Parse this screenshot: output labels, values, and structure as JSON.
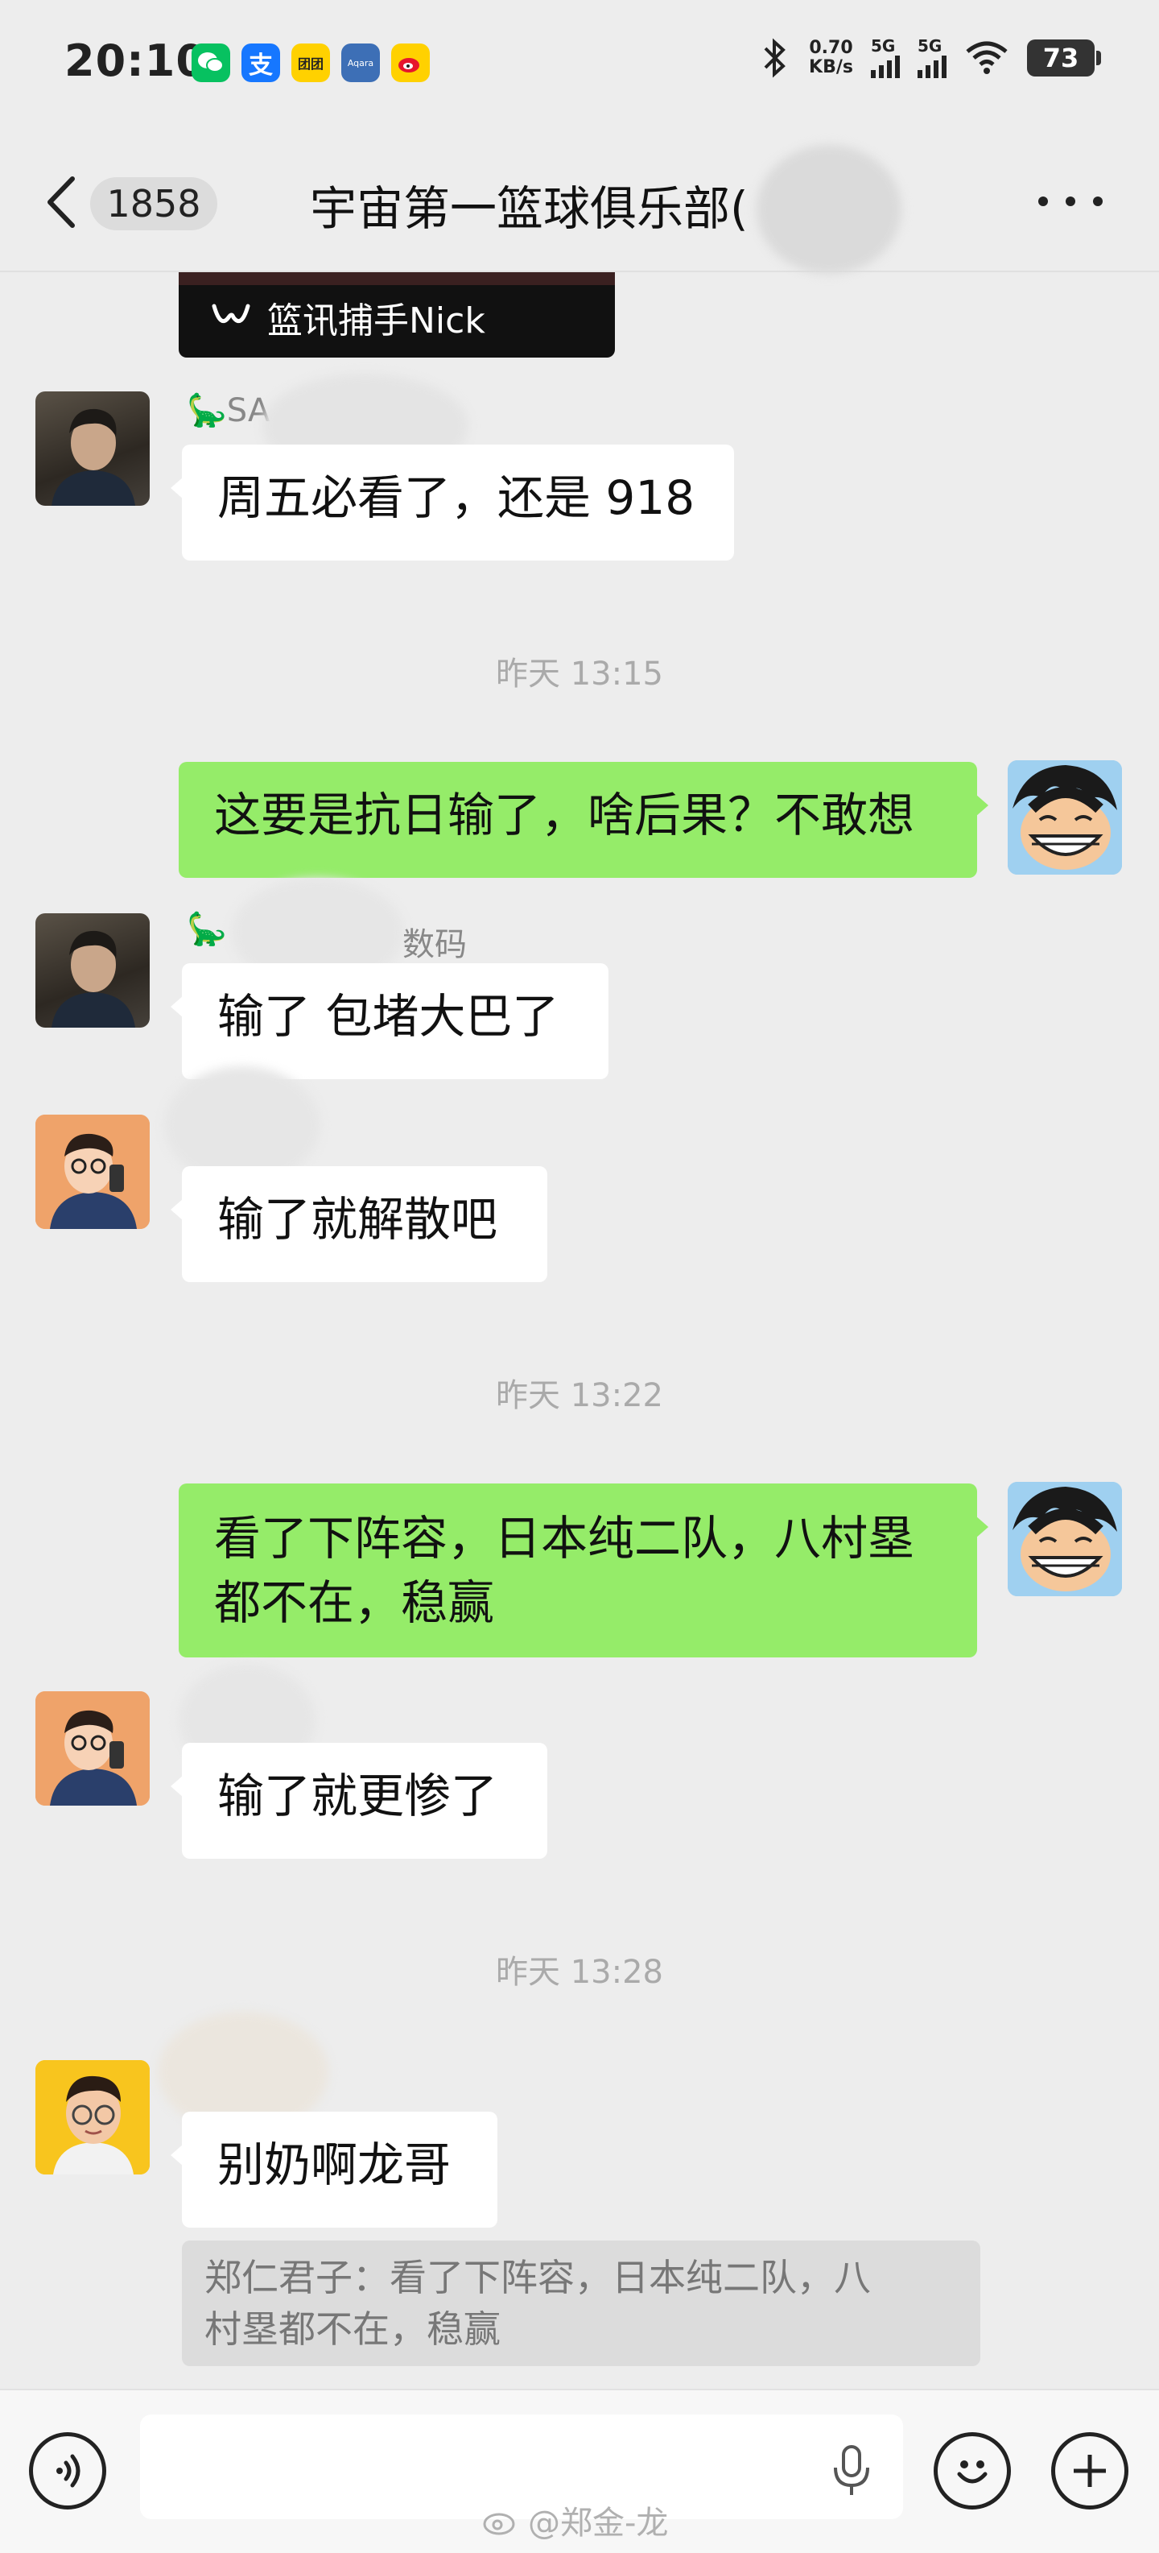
{
  "status_bar": {
    "time": "20:10",
    "net_speed_value": "0.70",
    "net_speed_unit": "KB/s",
    "signal1_label": "5G",
    "signal2_label": "5G",
    "battery": "73",
    "app_icons": [
      "wechat-icon",
      "alipay-icon",
      "meituan-icon",
      "aqara-icon",
      "weibo-icon"
    ],
    "meituan_text": "团团",
    "aqara_text": "Aqara"
  },
  "nav": {
    "unread_count": "1858",
    "title": "宇宙第一篮球俱乐部("
  },
  "messages": {
    "video_card_caption": "篮讯捕手Nick",
    "m1_sender": "🦕SA",
    "m1_text": "周五必看了，还是 918",
    "ts1": "昨天 13:15",
    "m2_text": "这要是抗日输了，啥后果？不敢想",
    "m3_sender_prefix": "🦕",
    "m3_sender_suffix": "数码",
    "m3_text": "输了 包堵大巴了",
    "m4_text": "输了就解散吧",
    "ts2": "昨天 13:22",
    "m5_line1": "看了下阵容，日本纯二队，八村塁",
    "m5_line2": "都不在，稳赢",
    "m6_text": "输了就更惨了",
    "ts3": "昨天 13:28",
    "m7_text": "别奶啊龙哥",
    "m7_quote_line1": "郑仁君子：看了下阵容，日本纯二队，八",
    "m7_quote_line2": "村塁都不在，稳赢"
  },
  "input_bar": {
    "placeholder": ""
  },
  "watermark": "@郑金-龙",
  "colors": {
    "background": "#ededed",
    "own_bubble": "#95ec69",
    "other_bubble": "#ffffff",
    "wechat_green": "#07c160",
    "alipay_blue": "#1677ff",
    "meituan_yellow": "#ffd100",
    "weibo_red": "#e6162d"
  }
}
